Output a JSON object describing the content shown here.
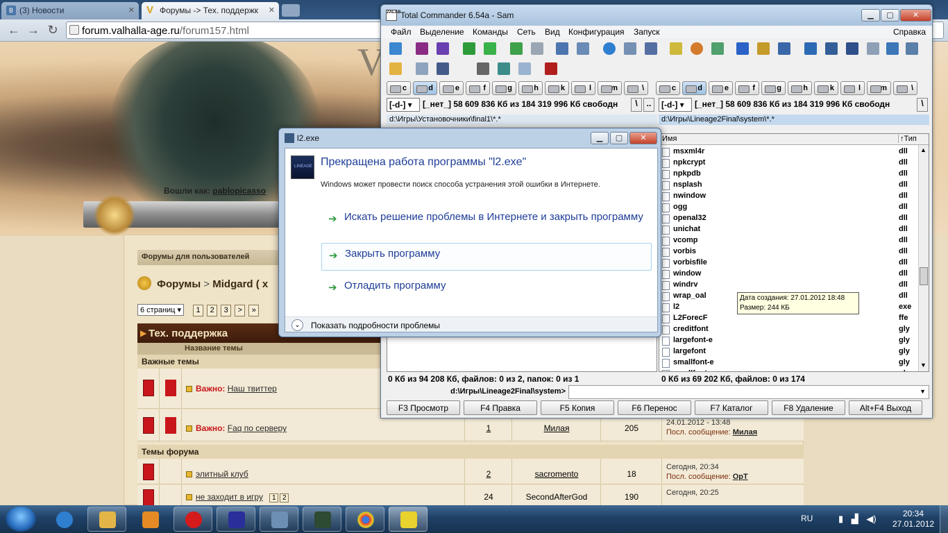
{
  "browser": {
    "tabs": [
      {
        "title": "(3) Новости",
        "state": "inactive"
      },
      {
        "title": "Форумы -> Тех. поддержк",
        "state": "active"
      }
    ],
    "url_host": "forum.valhalla-age.ru",
    "url_path": "/forum157.html",
    "banner_letters": "VA",
    "login_label": "Вошли как:",
    "login_user": "pablopicasso"
  },
  "forum": {
    "crumb_bar": "Форумы для пользователей",
    "breadcrumb_root": "Форумы",
    "breadcrumb_sep": ">",
    "breadcrumb_current": "Midgard ( x",
    "pages_select": "6 страниц",
    "pages": [
      "1",
      "2",
      "3",
      ">",
      "»"
    ],
    "section_title": "Тех. поддержка",
    "column_title": "Название темы",
    "important_label": "Важные темы",
    "forum_topics_label": "Темы форума",
    "topics": [
      {
        "prefix": "Важно:",
        "title": "Наш твиттер",
        "replies": "",
        "author": "",
        "views": "",
        "last_date": "",
        "last_label": "",
        "last_user": ""
      },
      {
        "prefix": "Важно:",
        "title": "Faq по серверу",
        "replies": "1",
        "author": "Милая",
        "views": "205",
        "last_date": "24.01.2012 - 13:48",
        "last_label": "Посл. сообщение:",
        "last_user": "Милая"
      },
      {
        "prefix": "",
        "title": "элитный клуб",
        "replies": "2",
        "author": "sacromento",
        "views": "18",
        "last_date": "Сегодня, 20:34",
        "last_label": "Посл. сообщение:",
        "last_user": "OpT"
      },
      {
        "prefix": "",
        "title": "не заходит в игру",
        "pages": [
          "1",
          "2"
        ],
        "replies": "24",
        "author": "SecondAfterGod",
        "views": "190",
        "last_date": "Сегодня, 20:25",
        "last_label": "",
        "last_user": ""
      }
    ]
  },
  "tc": {
    "title": "Total Commander 6.54a - Sam",
    "logo": "ZALAB",
    "window_buttons": {
      "minimize": "▁",
      "maximize": "▢",
      "close": "✕"
    },
    "menu": [
      "Файл",
      "Выделение",
      "Команды",
      "Сеть",
      "Вид",
      "Конфигурация",
      "Запуск"
    ],
    "menu_help": "Справка",
    "drives": [
      "c",
      "d",
      "e",
      "f",
      "g",
      "h",
      "k",
      "l",
      "m",
      "\\"
    ],
    "left_drive_select": "[-d-]",
    "left_info": "[_нет_]  58 609 836 Кб из 184 319 996 Кб свободн",
    "right_drive_select": "[-d-]",
    "right_info": "[_нет_]  58 609 836 Кб из 184 319 996 Кб свободн",
    "path_btn_root": "\\",
    "path_btn_up": "..",
    "left_path": "d:\\Игры\\Установочники\\final1\\*.*",
    "right_path": "d:\\Игры\\Lineage2Final\\system\\*.*",
    "col_name": "Имя",
    "col_type": "↑Тип",
    "files": [
      {
        "name": "msxml4r",
        "ext": "dll"
      },
      {
        "name": "npkcrypt",
        "ext": "dll"
      },
      {
        "name": "npkpdb",
        "ext": "dll"
      },
      {
        "name": "nsplash",
        "ext": "dll"
      },
      {
        "name": "nwindow",
        "ext": "dll"
      },
      {
        "name": "ogg",
        "ext": "dll"
      },
      {
        "name": "openal32",
        "ext": "dll"
      },
      {
        "name": "unichat",
        "ext": "dll"
      },
      {
        "name": "vcomp",
        "ext": "dll"
      },
      {
        "name": "vorbis",
        "ext": "dll"
      },
      {
        "name": "vorbisfile",
        "ext": "dll"
      },
      {
        "name": "window",
        "ext": "dll"
      },
      {
        "name": "windrv",
        "ext": "dll"
      },
      {
        "name": "wrap_oal",
        "ext": "dll"
      },
      {
        "name": "l2",
        "ext": "exe"
      },
      {
        "name": "L2ForecF",
        "ext": "ffe"
      },
      {
        "name": "creditfont",
        "ext": "gly"
      },
      {
        "name": "largefont-e",
        "ext": "gly"
      },
      {
        "name": "largefont",
        "ext": "gly"
      },
      {
        "name": "smallfont-e",
        "ext": "gly"
      },
      {
        "name": "smallfont",
        "ext": "gly"
      }
    ],
    "tooltip_line1": "Дата создания: 27.01.2012 18:48",
    "tooltip_line2": "Размер: 244 КБ",
    "left_status": "0 Кб из 94 208 Кб, файлов: 0 из 2, папок: 0 из 1",
    "right_status": "0 Кб из 69 202 Кб, файлов: 0 из 174",
    "cmd_path": "d:\\Игры\\Lineage2Final\\system>",
    "fkeys": [
      "F3 Просмотр",
      "F4 Правка",
      "F5 Копия",
      "F6 Перенос",
      "F7 Каталог",
      "F8 Удаление",
      "Alt+F4 Выход"
    ]
  },
  "dialog": {
    "title": "l2.exe",
    "app_icon_text": "LINEAGE",
    "heading": "Прекращена работа программы \"l2.exe\"",
    "subtext": "Windows может провести поиск способа устранения этой ошибки в Интернете.",
    "option1": "Искать решение проблемы в Интернете и закрыть программу",
    "option2": "Закрыть программу",
    "option3": "Отладить программу",
    "details": "Показать подробности проблемы"
  },
  "taskbar": {
    "lang": "RU",
    "time": "20:34",
    "date": "27.01.2012",
    "apps": [
      "explorer-icon",
      "media-player-icon",
      "opera-icon",
      "floppy-save-icon",
      "network-icon",
      "terminal-icon",
      "chrome-icon",
      "total-commander-icon"
    ]
  },
  "colors": {
    "accent_link": "#1e3d97",
    "important_red": "#c8161c",
    "forum_header_brown": "#4a2410"
  }
}
